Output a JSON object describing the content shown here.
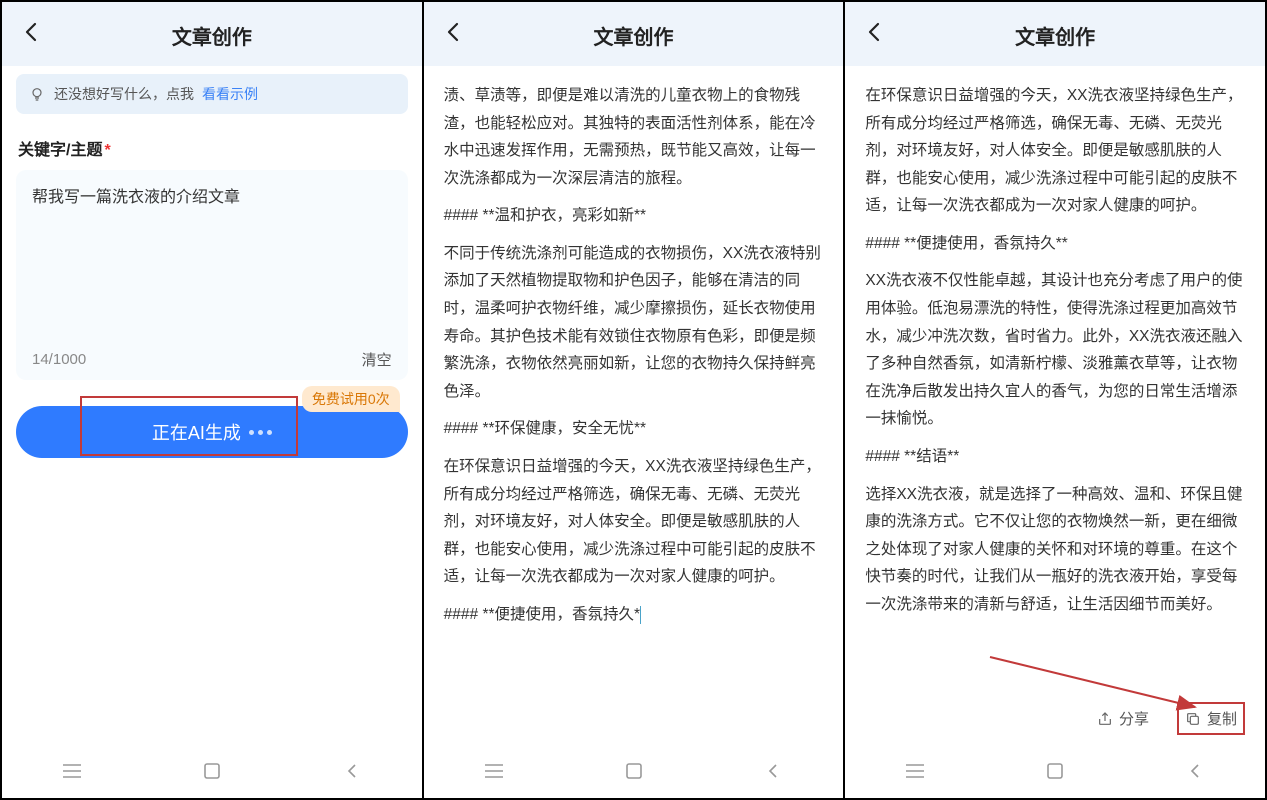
{
  "header": {
    "title": "文章创作"
  },
  "hint": {
    "prefix": "还没想好写什么，点我 ",
    "link": "看看示例"
  },
  "field": {
    "label": "关键字/主题",
    "required_mark": "*"
  },
  "input": {
    "value": "帮我写一篇洗衣液的介绍文章",
    "counter": "14/1000",
    "clear_label": "清空"
  },
  "trial_tag": "免费试用0次",
  "generate": {
    "loading_label": "正在AI生成"
  },
  "screen2": {
    "paragraphs": [
      "渍、草渍等，即便是难以清洗的儿童衣物上的食物残渣，也能轻松应对。其独特的表面活性剂体系，能在冷水中迅速发挥作用，无需预热，既节能又高效，让每一次洗涤都成为一次深层清洁的旅程。",
      "#### **温和护衣，亮彩如新**",
      "不同于传统洗涤剂可能造成的衣物损伤，XX洗衣液特别添加了天然植物提取物和护色因子，能够在清洁的同时，温柔呵护衣物纤维，减少摩擦损伤，延长衣物使用寿命。其护色技术能有效锁住衣物原有色彩，即便是频繁洗涤，衣物依然亮丽如新，让您的衣物持久保持鲜亮色泽。",
      "#### **环保健康，安全无忧**",
      "在环保意识日益增强的今天，XX洗衣液坚持绿色生产，所有成分均经过严格筛选，确保无毒、无磷、无荧光剂，对环境友好，对人体安全。即便是敏感肌肤的人群，也能安心使用，减少洗涤过程中可能引起的皮肤不适，让每一次洗衣都成为一次对家人健康的呵护。",
      "#### **便捷使用，香氛持久*"
    ]
  },
  "screen3": {
    "paragraphs": [
      "在环保意识日益增强的今天，XX洗衣液坚持绿色生产，所有成分均经过严格筛选，确保无毒、无磷、无荧光剂，对环境友好，对人体安全。即便是敏感肌肤的人群，也能安心使用，减少洗涤过程中可能引起的皮肤不适，让每一次洗衣都成为一次对家人健康的呵护。",
      "#### **便捷使用，香氛持久**",
      "XX洗衣液不仅性能卓越，其设计也充分考虑了用户的使用体验。低泡易漂洗的特性，使得洗涤过程更加高效节水，减少冲洗次数，省时省力。此外，XX洗衣液还融入了多种自然香氛，如清新柠檬、淡雅薰衣草等，让衣物在洗净后散发出持久宜人的香气，为您的日常生活增添一抹愉悦。",
      "#### **结语**",
      "选择XX洗衣液，就是选择了一种高效、温和、环保且健康的洗涤方式。它不仅让您的衣物焕然一新，更在细微之处体现了对家人健康的关怀和对环境的尊重。在这个快节奏的时代，让我们从一瓶好的洗衣液开始，享受每一次洗涤带来的清新与舒适，让生活因细节而美好。"
    ]
  },
  "actions": {
    "share": "分享",
    "copy": "复制"
  },
  "nav": {
    "menu": "≡",
    "home": "◯",
    "back": "‹"
  }
}
